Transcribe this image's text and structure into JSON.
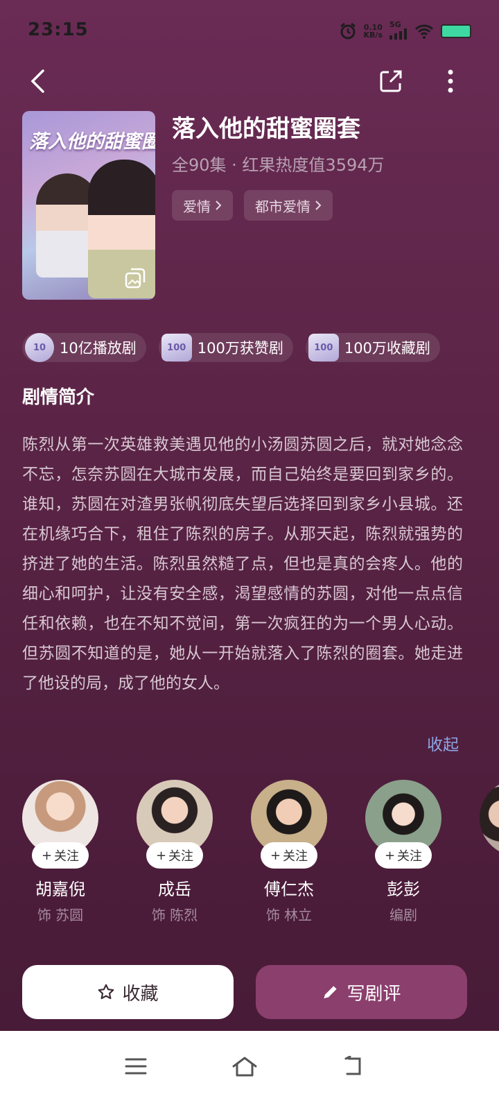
{
  "status": {
    "time": "23:15",
    "net_speed": "0.10",
    "net_unit": "KB/s",
    "signal": "5G"
  },
  "drama": {
    "title": "落入他的甜蜜圈套",
    "meta": "全90集 · 红果热度值3594万",
    "tags": [
      "爱情",
      "都市爱情"
    ],
    "poster_title": "落入他的甜蜜圈套"
  },
  "badges": [
    {
      "icon_text": "10",
      "label": "10亿播放剧"
    },
    {
      "icon_text": "100",
      "label": "100万获赞剧"
    },
    {
      "icon_text": "100",
      "label": "100万收藏剧"
    }
  ],
  "synopsis": {
    "heading": "剧情简介",
    "text": "陈烈从第一次英雄救美遇见他的小汤圆苏圆之后，就对她念念不忘，怎奈苏圆在大城市发展，而自己始终是要回到家乡的。谁知，苏圆在对渣男张帆彻底失望后选择回到家乡小县城。还在机缘巧合下，租住了陈烈的房子。从那天起，陈烈就强势的挤进了她的生活。陈烈虽然糙了点，但也是真的会疼人。他的细心和呵护，让没有安全感，渴望感情的苏圆，对他一点点信任和依赖，也在不知不觉间，第一次疯狂的为一个男人心动。但苏圆不知道的是，她从一开始就落入了陈烈的圈套。她走进了他设的局，成了他的女人。",
    "collapse": "收起"
  },
  "cast": [
    {
      "name": "胡嘉倪",
      "role": "饰 苏圆",
      "follow": "关注"
    },
    {
      "name": "成岳",
      "role": "饰 陈烈",
      "follow": "关注"
    },
    {
      "name": "傅仁杰",
      "role": "饰 林立",
      "follow": "关注"
    },
    {
      "name": "彭彭",
      "role": "编剧",
      "follow": "关注"
    }
  ],
  "actions": {
    "favorite": "收藏",
    "review": "写剧评"
  },
  "colors": {
    "accent": "#8b3f6d",
    "link": "#8ea6e6"
  }
}
